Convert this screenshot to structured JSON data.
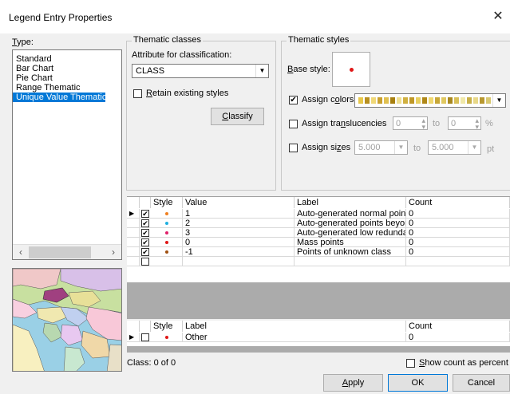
{
  "window": {
    "title": "Legend Entry Properties",
    "close": "✕"
  },
  "type_panel": {
    "label": "Type:",
    "items": [
      "Standard",
      "Bar Chart",
      "Pie Chart",
      "Range Thematic",
      "Unique Value Thematic"
    ],
    "selected_index": 4
  },
  "thematic_classes": {
    "caption": "Thematic classes",
    "attribute_label": "Attribute for classification:",
    "attribute_value": "CLASS",
    "retain_label": "Retain existing styles",
    "retain_checked": false,
    "classify_label": "Classify"
  },
  "thematic_styles": {
    "caption": "Thematic styles",
    "base_style_label": "Base style:",
    "assign_colors_label": "Assign colors",
    "assign_colors_checked": true,
    "assign_translucencies_label": "Assign translucencies",
    "assign_translucencies_checked": false,
    "translucency_from": "0",
    "translucency_to": "0",
    "to_label": "to",
    "percent_label": "%",
    "assign_sizes_label": "Assign sizes",
    "assign_sizes_checked": false,
    "size_from": "5.000",
    "size_to": "5.000",
    "pt_label": "pt",
    "palette": [
      "#e8c84a",
      "#b89020",
      "#f0d878",
      "#c8a030",
      "#e0c050",
      "#a88010",
      "#f0e090",
      "#d0b040",
      "#c09828",
      "#e8d060",
      "#b08818",
      "#f0d870",
      "#c8a838",
      "#e0c860",
      "#a88820",
      "#d8c058",
      "#f0e8a8",
      "#c8b048",
      "#e8d888",
      "#b89830",
      "#d8c870"
    ]
  },
  "classes_grid": {
    "headers": [
      "Style",
      "Value",
      "Label",
      "Count"
    ],
    "rows": [
      {
        "color": "#f08020",
        "value": "1",
        "label": "Auto-generated normal points",
        "count": "0",
        "checked": true
      },
      {
        "color": "#20b0e0",
        "value": "2",
        "label": "Auto-generated points beyond",
        "count": "0",
        "checked": true
      },
      {
        "color": "#e0206a",
        "value": "3",
        "label": "Auto-generated low redundancy",
        "count": "0",
        "checked": true
      },
      {
        "color": "#e01818",
        "value": "0",
        "label": "Mass points",
        "count": "0",
        "checked": true
      },
      {
        "color": "#a05010",
        "value": "-1",
        "label": "Points of unknown class",
        "count": "0",
        "checked": true
      }
    ]
  },
  "other_grid": {
    "headers": [
      "Style",
      "Label",
      "Count"
    ],
    "row": {
      "color": "#e01818",
      "label": "Other",
      "count": "0",
      "checked": false
    }
  },
  "footer": {
    "class_status": "Class: 0 of 0",
    "show_percent_label": "Show count as percent",
    "apply_label": "Apply",
    "ok_label": "OK",
    "cancel_label": "Cancel"
  }
}
